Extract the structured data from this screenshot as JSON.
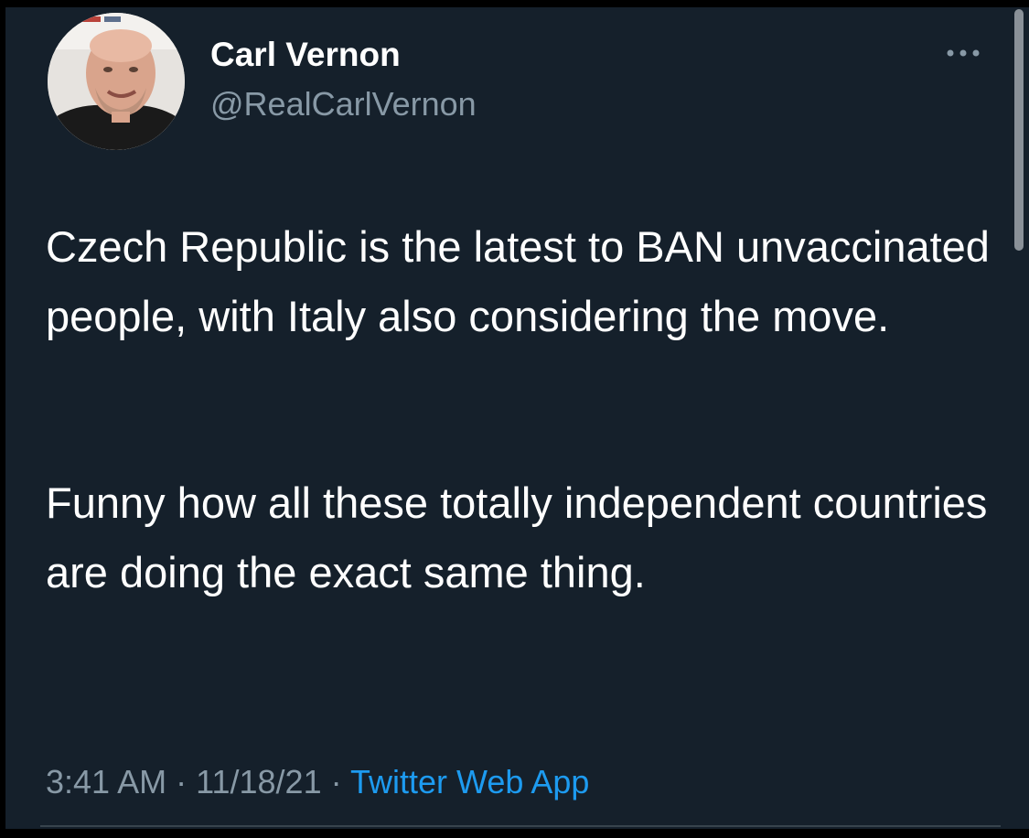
{
  "tweet": {
    "author": {
      "display_name": "Carl Vernon",
      "handle": "@RealCarlVernon"
    },
    "paragraphs": [
      "Czech Republic is the latest to BAN unvaccinated people, with Italy also considering the move.",
      "Funny how all these totally independent countries are doing the exact same thing."
    ],
    "time": "3:41 AM",
    "date": "11/18/21",
    "separator": "·",
    "source": "Twitter Web App"
  },
  "icons": {
    "more": "more-horizontal-icon"
  },
  "colors": {
    "background": "#15202b",
    "text_primary": "#ffffff",
    "text_secondary": "#8899a6",
    "link": "#1d9bf0"
  }
}
